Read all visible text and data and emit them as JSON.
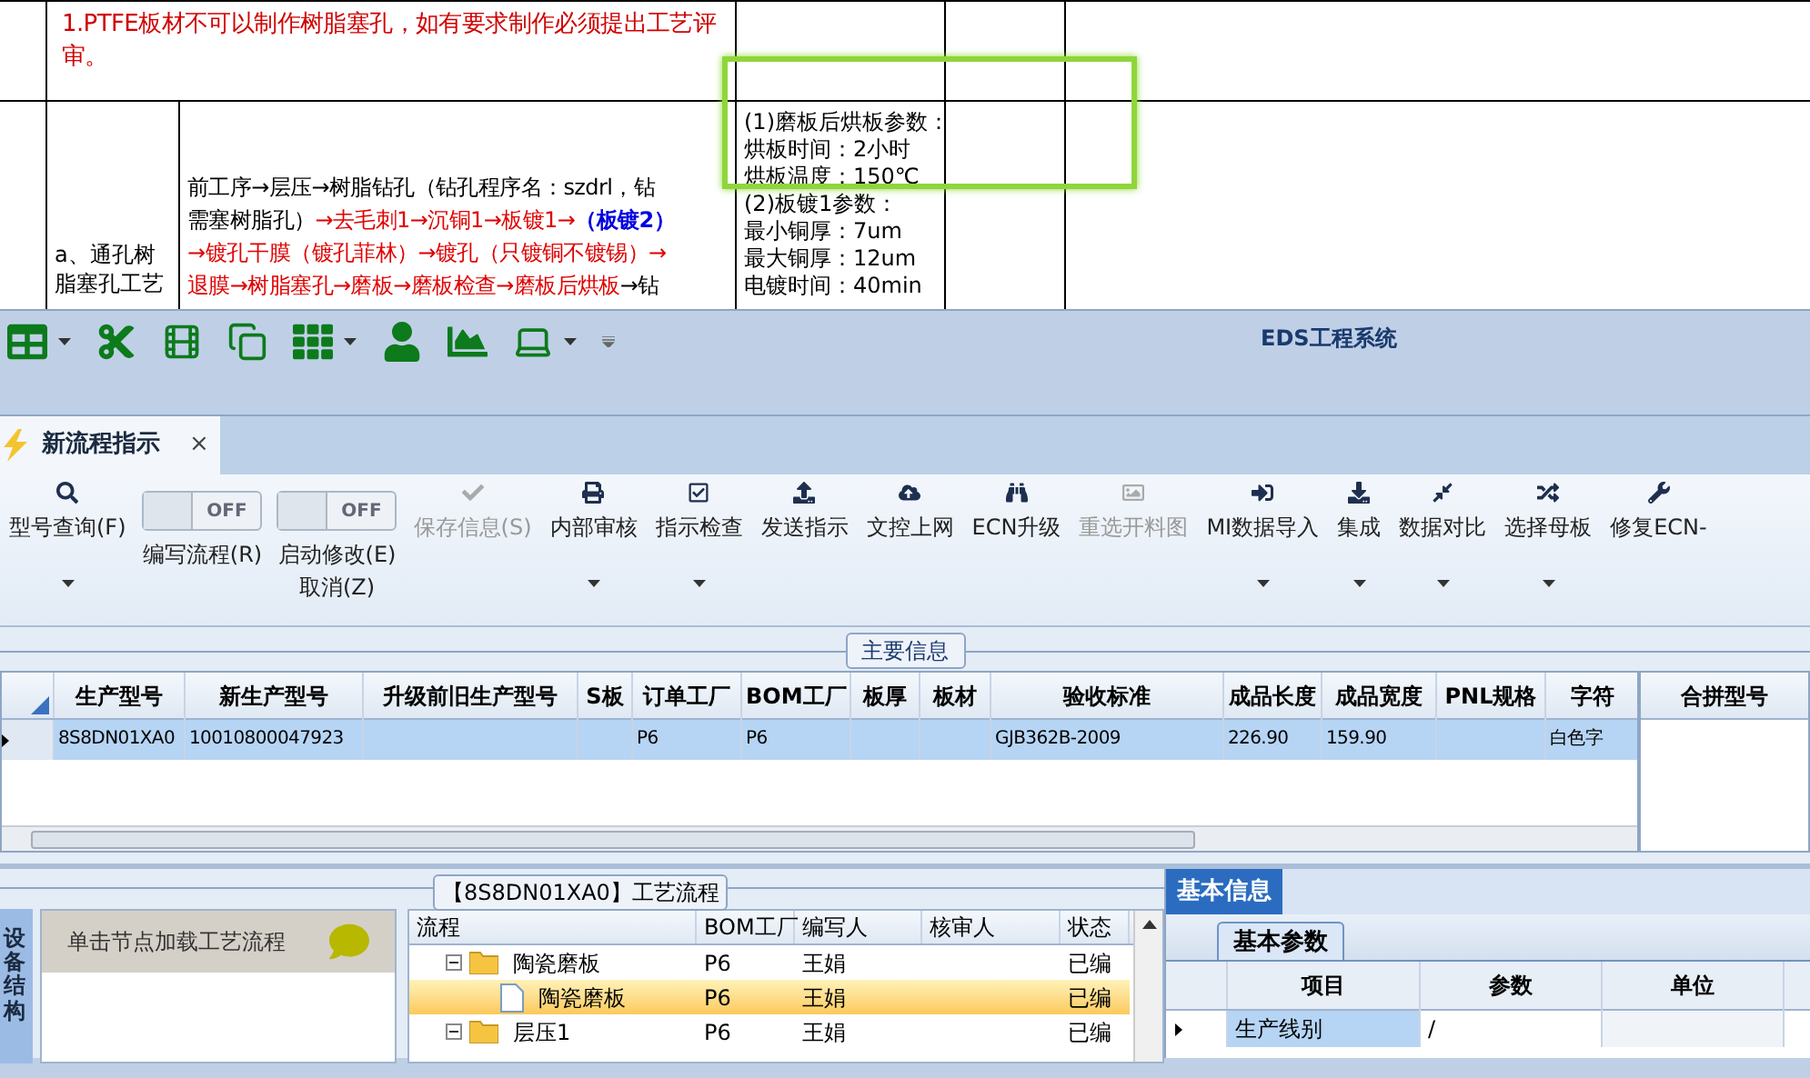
{
  "document": {
    "note": "1.PTFE板材不可以制作树脂塞孔，如有要求制作必须提出工艺评审。",
    "process_name": "a、通孔树脂塞孔工艺",
    "process_lines": [
      [
        {
          "text": "前工序→层压→树脂钻孔（钻孔程序名：szdrl，钻",
          "color": "#000000",
          "bold": false
        }
      ],
      [
        {
          "text": "需塞树脂孔）",
          "color": "#000000",
          "bold": false
        },
        {
          "text": "→去毛刺1→沉铜1→板镀1→",
          "color": "#e00000",
          "bold": false
        },
        {
          "text": "（板镀2）",
          "color": "#0000e0",
          "bold": true
        }
      ],
      [
        {
          "text": "→镀孔干膜（镀孔菲林）→镀孔（只镀铜不镀锡）→",
          "color": "#e00000",
          "bold": false
        }
      ],
      [
        {
          "text": "退膜→树脂塞孔→磨板→磨板检查→磨板后烘板",
          "color": "#e00000",
          "bold": false
        },
        {
          "text": "→钻",
          "color": "#000000",
          "bold": false
        }
      ]
    ],
    "params": [
      "(1)磨板后烘板参数：",
      "烘板时间：2小时",
      "烘板温度：150℃",
      "(2)板镀1参数：",
      "最小铜厚：7um",
      "最大铜厚：12um",
      "电镀时间：40min"
    ]
  },
  "window": {
    "title": "EDS工程系统"
  },
  "tabs": [
    {
      "label": "新流程指示",
      "selected": true,
      "close": "×"
    }
  ],
  "ribbon": {
    "items": [
      {
        "kind": "button",
        "label": "型号查询(F)",
        "disabled": false,
        "dropdown": true
      },
      {
        "kind": "toggle",
        "label": "编写流程(R)",
        "on": false,
        "switch_text": "OFF"
      },
      {
        "kind": "toggle",
        "label": "启动修改(E)",
        "sublabel": "取消(Z)",
        "on": false,
        "switch_text": "OFF"
      },
      {
        "kind": "button",
        "label": "保存信息(S)",
        "disabled": true,
        "dropdown": false
      },
      {
        "kind": "button",
        "label": "内部审核",
        "disabled": false,
        "dropdown": true
      },
      {
        "kind": "button",
        "label": "指示检查",
        "disabled": false,
        "dropdown": true
      },
      {
        "kind": "button",
        "label": "发送指示",
        "disabled": false,
        "dropdown": false
      },
      {
        "kind": "button",
        "label": "文控上网",
        "disabled": false,
        "dropdown": false
      },
      {
        "kind": "button",
        "label": "ECN升级",
        "disabled": false,
        "dropdown": false
      },
      {
        "kind": "button",
        "label": "重选开料图",
        "disabled": true,
        "dropdown": false
      },
      {
        "kind": "button",
        "label": "MI数据导入",
        "disabled": false,
        "dropdown": true
      },
      {
        "kind": "button",
        "label": "集成",
        "disabled": false,
        "dropdown": true
      },
      {
        "kind": "button",
        "label": "数据对比",
        "disabled": false,
        "dropdown": true
      },
      {
        "kind": "button",
        "label": "选择母板",
        "disabled": false,
        "dropdown": true
      },
      {
        "kind": "button",
        "label": "修复ECN-",
        "disabled": false,
        "dropdown": false
      }
    ]
  },
  "main_info": {
    "title": "主要信息",
    "columns": [
      "生产型号",
      "新生产型号",
      "升级前旧生产型号",
      "S板",
      "订单工厂",
      "BOM工厂",
      "板厚",
      "板材",
      "验收标准",
      "成品长度",
      "成品宽度",
      "PNL规格",
      "字符"
    ],
    "rows": [
      {
        "selected": true,
        "cells": [
          "8S8DN01XA0",
          "10010800047923",
          null,
          null,
          "P6",
          "P6",
          null,
          null,
          "GJB362B-2009",
          "226.90",
          "159.90",
          null,
          "白色字"
        ]
      }
    ],
    "side_column": "合拼型号"
  },
  "process_flow": {
    "title": "【8S8DN01XA0】工艺流程",
    "side_tab": "设备结构",
    "hint": "单击节点加载工艺流程",
    "columns": [
      "流程",
      "BOM工厂",
      "编写人",
      "核审人",
      "状态"
    ],
    "rows": [
      {
        "kind": "folder",
        "expanded": true,
        "selected": false,
        "cells": [
          "陶瓷磨板",
          "P6",
          "王娟",
          null,
          "已编"
        ],
        "children": [
          {
            "kind": "file",
            "selected": true,
            "cells": [
              "陶瓷磨板",
              "P6",
              "王娟",
              null,
              "已编"
            ]
          }
        ]
      },
      {
        "kind": "folder",
        "expanded": true,
        "selected": false,
        "cells": [
          "层压1",
          "P6",
          "王娟",
          null,
          "已编"
        ]
      }
    ]
  },
  "basic_info": {
    "tabs": [
      {
        "label": "基本信息",
        "selected": true
      }
    ],
    "subtabs": [
      {
        "label": "基本参数",
        "selected": true
      }
    ],
    "columns": [
      "项目",
      "参数",
      "单位"
    ],
    "rows": [
      {
        "selected": true,
        "cells": [
          "生产线别",
          "/",
          null
        ]
      }
    ]
  }
}
